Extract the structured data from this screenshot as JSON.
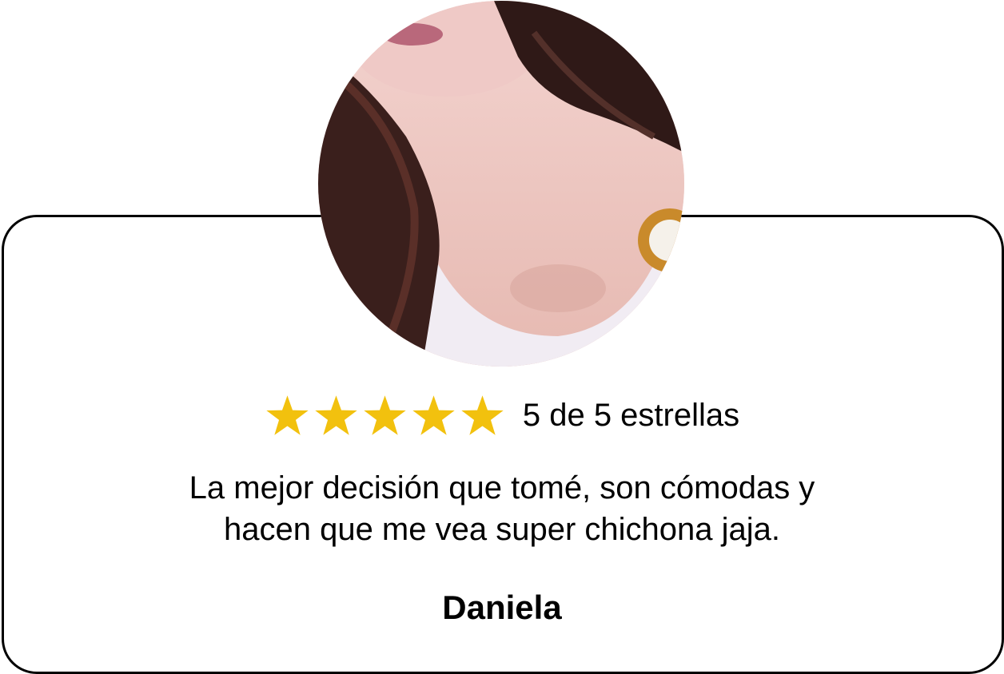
{
  "review": {
    "rating": 5,
    "rating_max": 5,
    "star_color": "#F2C10E",
    "rating_text": "5 de 5 estrellas",
    "quote_lines": [
      "La mejor decisión que tomé, son cómodas y",
      "hacen que me vea super chichona jaja."
    ],
    "author": "Daniela"
  },
  "avatar": {
    "icon": "reviewer-photo"
  }
}
